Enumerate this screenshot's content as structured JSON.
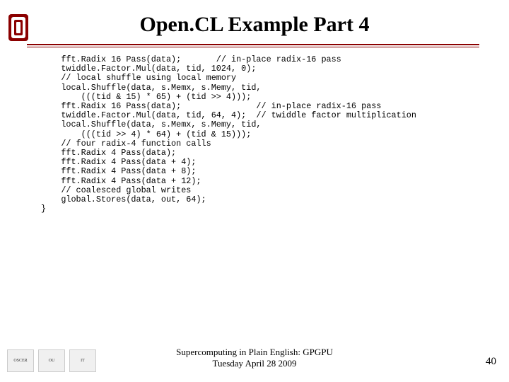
{
  "title": "Open.CL Example Part 4",
  "code": {
    "l1": "    fft.Radix 16 Pass(data);       // in-place radix-16 pass",
    "l2": "    twiddle.Factor.Mul(data, tid, 1024, 0);",
    "l3": "    // local shuffle using local memory",
    "l4": "    local.Shuffle(data, s.Memx, s.Memy, tid,",
    "l5": "        (((tid & 15) * 65) + (tid >> 4)));",
    "l6": "    fft.Radix 16 Pass(data);               // in-place radix-16 pass",
    "l7": "    twiddle.Factor.Mul(data, tid, 64, 4);  // twiddle factor multiplication",
    "l8": "    local.Shuffle(data, s.Memx, s.Memy, tid,",
    "l9": "        (((tid >> 4) * 64) + (tid & 15)));",
    "l10": "    // four radix-4 function calls",
    "l11": "    fft.Radix 4 Pass(data);",
    "l12": "    fft.Radix 4 Pass(data + 4);",
    "l13": "    fft.Radix 4 Pass(data + 8);",
    "l14": "    fft.Radix 4 Pass(data + 12);",
    "l15": "    // coalesced global writes",
    "l16": "    global.Stores(data, out, 64);",
    "l17": "}"
  },
  "footer": {
    "line1": "Supercomputing in Plain English: GPGPU",
    "line2": "Tuesday April 28 2009",
    "logos": {
      "a": "OSCER",
      "b": "OU",
      "c": "IT"
    }
  },
  "slide_number": "40",
  "colors": {
    "accent": "#8b0000"
  }
}
